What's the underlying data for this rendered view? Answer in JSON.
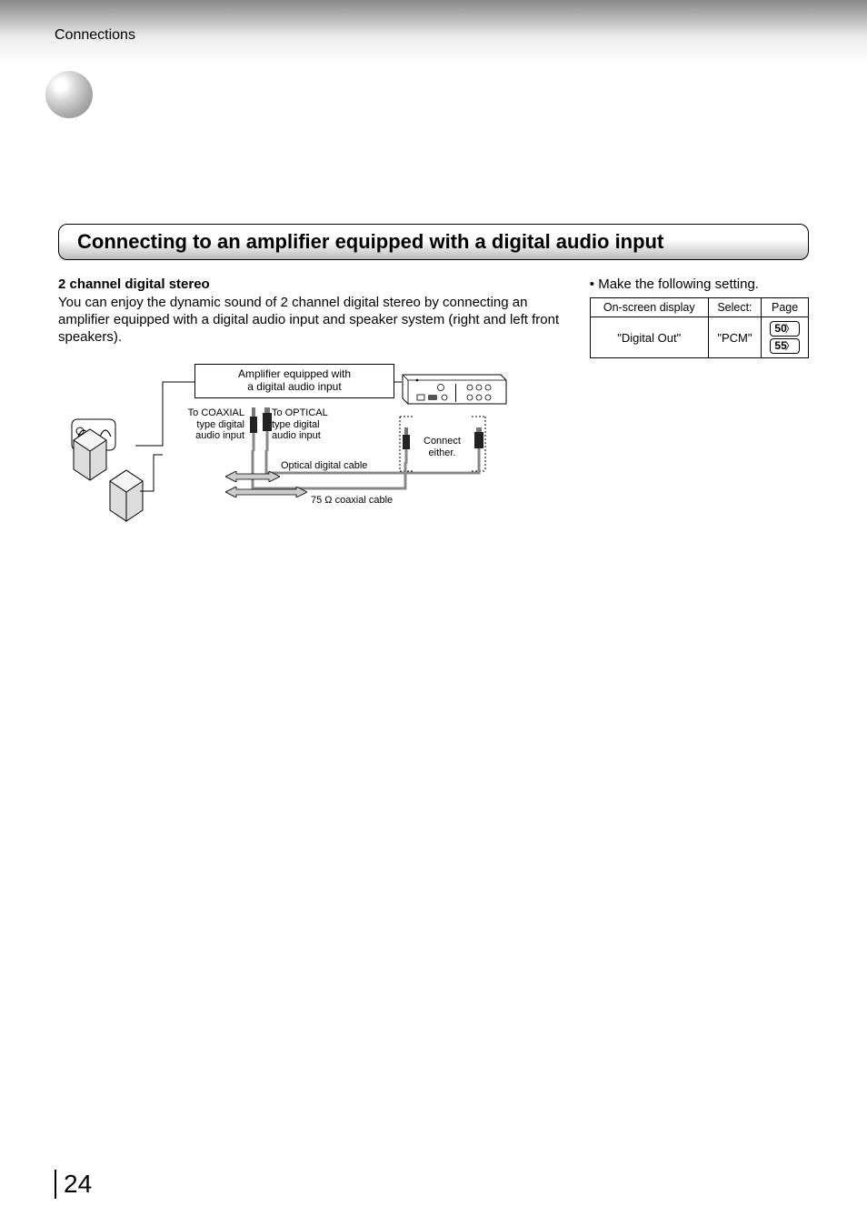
{
  "header": {
    "section": "Connections"
  },
  "title": "Connecting to an amplifier equipped with a digital audio input",
  "left": {
    "subheading": "2 channel digital stereo",
    "body": "You can enjoy the dynamic sound of 2 channel digital stereo by connecting an amplifier equipped with a digital audio input and speaker system (right and left front speakers)."
  },
  "diagram": {
    "amp_box_line1": "Amplifier equipped with",
    "amp_box_line2": "a digital audio input",
    "coax_label_line1": "To COAXIAL",
    "coax_label_line2": "type digital",
    "coax_label_line3": "audio input",
    "opt_label_line1": "To OPTICAL",
    "opt_label_line2": "type digital",
    "opt_label_line3": "audio input",
    "optical_cable": "Optical digital cable",
    "coaxial_cable": "75 Ω coaxial cable",
    "connect_either_line1": "Connect",
    "connect_either_line2": "either."
  },
  "right": {
    "bullet": "Make the following setting.",
    "table": {
      "headers": [
        "On-screen display",
        "Select:",
        "Page"
      ],
      "row": {
        "osd": "\"Digital Out\"",
        "select": "\"PCM\"",
        "pages": [
          "50",
          "55"
        ]
      }
    }
  },
  "page_number": "24"
}
